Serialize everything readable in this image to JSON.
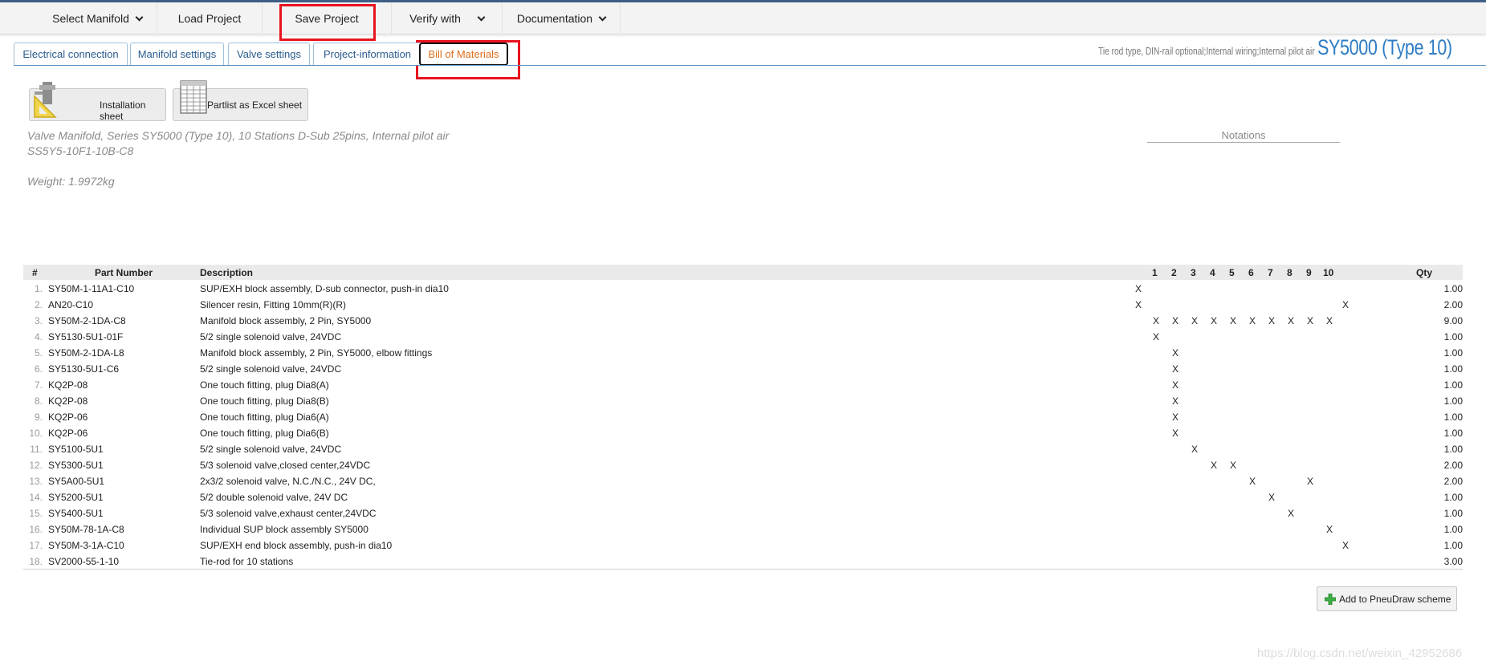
{
  "menu": {
    "select_manifold": "Select Manifold",
    "load_project": "Load Project",
    "save_project": "Save Project",
    "verify_with": "Verify with",
    "documentation": "Documentation"
  },
  "tabs": [
    "Electrical connection",
    "Manifold settings",
    "Valve settings",
    "Project-information",
    "Bill of Materials"
  ],
  "type_info": {
    "details": "Tie rod type, DIN-rail optional;Internal wiring;Internal pilot air",
    "series": "SY5000 (Type 10)"
  },
  "doc_buttons": {
    "installation": "Installation sheet",
    "partlist": "Partlist as Excel sheet"
  },
  "description": {
    "line1": "Valve Manifold, Series SY5000 (Type 10), 10 Stations D-Sub 25pins, Internal pilot air",
    "line2": "SS5Y5-10F1-10B-C8",
    "weight": "Weight: 1.9972kg"
  },
  "notations_label": "Notations",
  "bom": {
    "headers": {
      "num": "#",
      "part": "Part Number",
      "desc": "Description",
      "stations": [
        "1",
        "2",
        "3",
        "4",
        "5",
        "6",
        "7",
        "8",
        "9",
        "10"
      ],
      "qty": "Qty"
    },
    "rows": [
      {
        "num": "1.",
        "part": "SY50M-1-11A1-C10",
        "desc": "SUP/EXH block assembly, D-sub connector, push-in dia10",
        "x": [
          "L"
        ],
        "qty": "1.00"
      },
      {
        "num": "2.",
        "part": "AN20-C10",
        "desc": "Silencer resin, Fitting 10mm(R)(R)",
        "x": [
          "L",
          "R"
        ],
        "qty": "2.00"
      },
      {
        "num": "3.",
        "part": "SY50M-2-1DA-C8",
        "desc": "Manifold block assembly, 2 Pin, SY5000",
        "x": [
          "1",
          "2",
          "3",
          "4",
          "5",
          "6",
          "7",
          "8",
          "9",
          "10"
        ],
        "qty": "9.00"
      },
      {
        "num": "4.",
        "part": "SY5130-5U1-01F",
        "desc": "5/2 single solenoid valve, 24VDC",
        "x": [
          "1"
        ],
        "qty": "1.00"
      },
      {
        "num": "5.",
        "part": "SY50M-2-1DA-L8",
        "desc": "Manifold block assembly, 2 Pin, SY5000, elbow fittings",
        "x": [
          "2"
        ],
        "qty": "1.00"
      },
      {
        "num": "6.",
        "part": "SY5130-5U1-C6",
        "desc": "5/2 single solenoid valve, 24VDC",
        "x": [
          "2"
        ],
        "qty": "1.00"
      },
      {
        "num": "7.",
        "part": "KQ2P-08",
        "desc": "One touch fitting, plug Dia8(A)",
        "x": [
          "2"
        ],
        "qty": "1.00"
      },
      {
        "num": "8.",
        "part": "KQ2P-08",
        "desc": "One touch fitting, plug Dia8(B)",
        "x": [
          "2"
        ],
        "qty": "1.00"
      },
      {
        "num": "9.",
        "part": "KQ2P-06",
        "desc": "One touch fitting, plug Dia6(A)",
        "x": [
          "2"
        ],
        "qty": "1.00"
      },
      {
        "num": "10.",
        "part": "KQ2P-06",
        "desc": "One touch fitting, plug Dia6(B)",
        "x": [
          "2"
        ],
        "qty": "1.00"
      },
      {
        "num": "11.",
        "part": "SY5100-5U1",
        "desc": "5/2 single solenoid valve, 24VDC",
        "x": [
          "3"
        ],
        "qty": "1.00"
      },
      {
        "num": "12.",
        "part": "SY5300-5U1",
        "desc": "5/3 solenoid valve,closed center,24VDC",
        "x": [
          "4",
          "5"
        ],
        "qty": "2.00"
      },
      {
        "num": "13.",
        "part": "SY5A00-5U1",
        "desc": "2x3/2 solenoid valve, N.C./N.C., 24V DC,",
        "x": [
          "6",
          "9"
        ],
        "qty": "2.00"
      },
      {
        "num": "14.",
        "part": "SY5200-5U1",
        "desc": "5/2 double solenoid valve, 24V DC",
        "x": [
          "7"
        ],
        "qty": "1.00"
      },
      {
        "num": "15.",
        "part": "SY5400-5U1",
        "desc": "5/3 solenoid valve,exhaust center,24VDC",
        "x": [
          "8"
        ],
        "qty": "1.00"
      },
      {
        "num": "16.",
        "part": "SY50M-78-1A-C8",
        "desc": "Individual SUP block assembly SY5000",
        "x": [
          "10"
        ],
        "qty": "1.00"
      },
      {
        "num": "17.",
        "part": "SY50M-3-1A-C10",
        "desc": "SUP/EXH end block assembly, push-in dia10",
        "x": [
          "R"
        ],
        "qty": "1.00"
      },
      {
        "num": "18.",
        "part": "SV2000-55-1-10",
        "desc": "Tie-rod for 10 stations",
        "x": [],
        "qty": "3.00"
      }
    ]
  },
  "pneudraw_button": "Add to PneuDraw scheme",
  "watermark": "https://blog.csdn.net/weixin_42952686"
}
